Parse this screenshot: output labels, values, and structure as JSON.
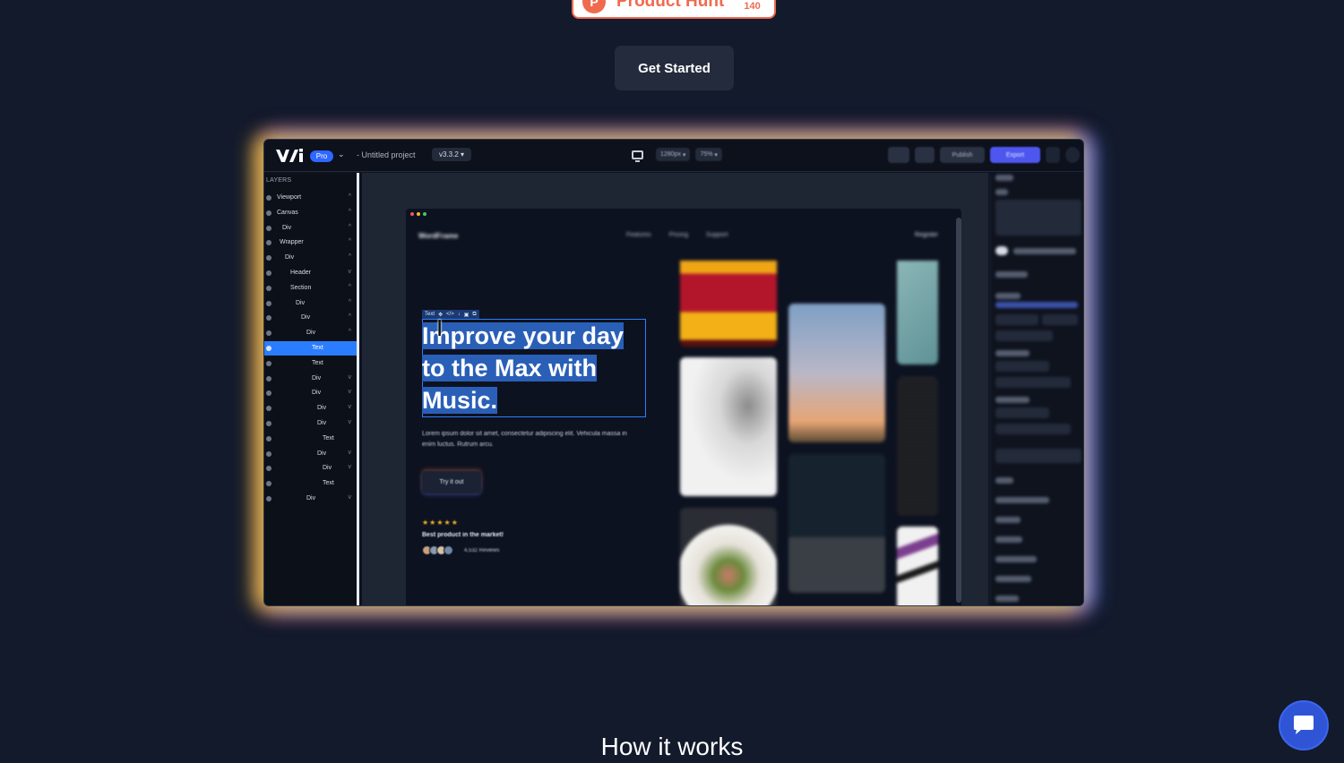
{
  "product_hunt": {
    "logo_letter": "P",
    "label": "Product Hunt",
    "count": "140",
    "color": "#f06a4e"
  },
  "hero": {
    "cta_label": "Get Started"
  },
  "editor": {
    "pro_badge": "Pro",
    "project_name": "- Untitled project",
    "version": "v3.3.2",
    "width_label": "1280px",
    "zoom_label": "75%",
    "publish_label": "Publish",
    "export_label": "Export",
    "layers_title": "LAYERS",
    "layers": [
      {
        "label": "Viewport",
        "chev": "^"
      },
      {
        "label": "Canvas",
        "chev": "^"
      },
      {
        "label": "Div",
        "chev": "^"
      },
      {
        "label": "Wrapper",
        "chev": "^"
      },
      {
        "label": "Div",
        "chev": "^"
      },
      {
        "label": "Header",
        "chev": "v"
      },
      {
        "label": "Section",
        "chev": "^"
      },
      {
        "label": "Div",
        "chev": "^"
      },
      {
        "label": "Div",
        "chev": "^"
      },
      {
        "label": "Div",
        "chev": "^"
      },
      {
        "label": "Text",
        "chev": "",
        "selected": true
      },
      {
        "label": "Text",
        "chev": ""
      },
      {
        "label": "Div",
        "chev": "v"
      },
      {
        "label": "Div",
        "chev": "v"
      },
      {
        "label": "Div",
        "chev": "v"
      },
      {
        "label": "Div",
        "chev": "v"
      },
      {
        "label": "Text",
        "chev": ""
      },
      {
        "label": "Div",
        "chev": "v"
      },
      {
        "label": "Div",
        "chev": "v"
      },
      {
        "label": "Text",
        "chev": ""
      },
      {
        "label": "Div",
        "chev": "v"
      }
    ],
    "preview": {
      "brand": "WordFrame",
      "nav_links": "Features Pricing Support",
      "register": "Register",
      "selection_tag": "Text",
      "headline": "Improve your day to the Max with Music.",
      "subtext": "Lorem ipsum dolor sit amet, consectetur adipiscing elit. Vehicula massa in enim luctus. Rutrum arcu.",
      "cta": "Try it out",
      "stars": "★★★★★",
      "best_product": "Best product in the market!",
      "reviews": "4,532 Reviews"
    }
  },
  "section": {
    "how_title": "How it works"
  },
  "colors": {
    "accent": "#2b7dff",
    "background": "#131a2c",
    "export": "#4d57f0",
    "chat": "#2f55d6"
  },
  "icons": [
    "product-hunt-logo",
    "monitor-icon",
    "undo-icon",
    "redo-icon",
    "eye-icon",
    "chat-icon"
  ]
}
